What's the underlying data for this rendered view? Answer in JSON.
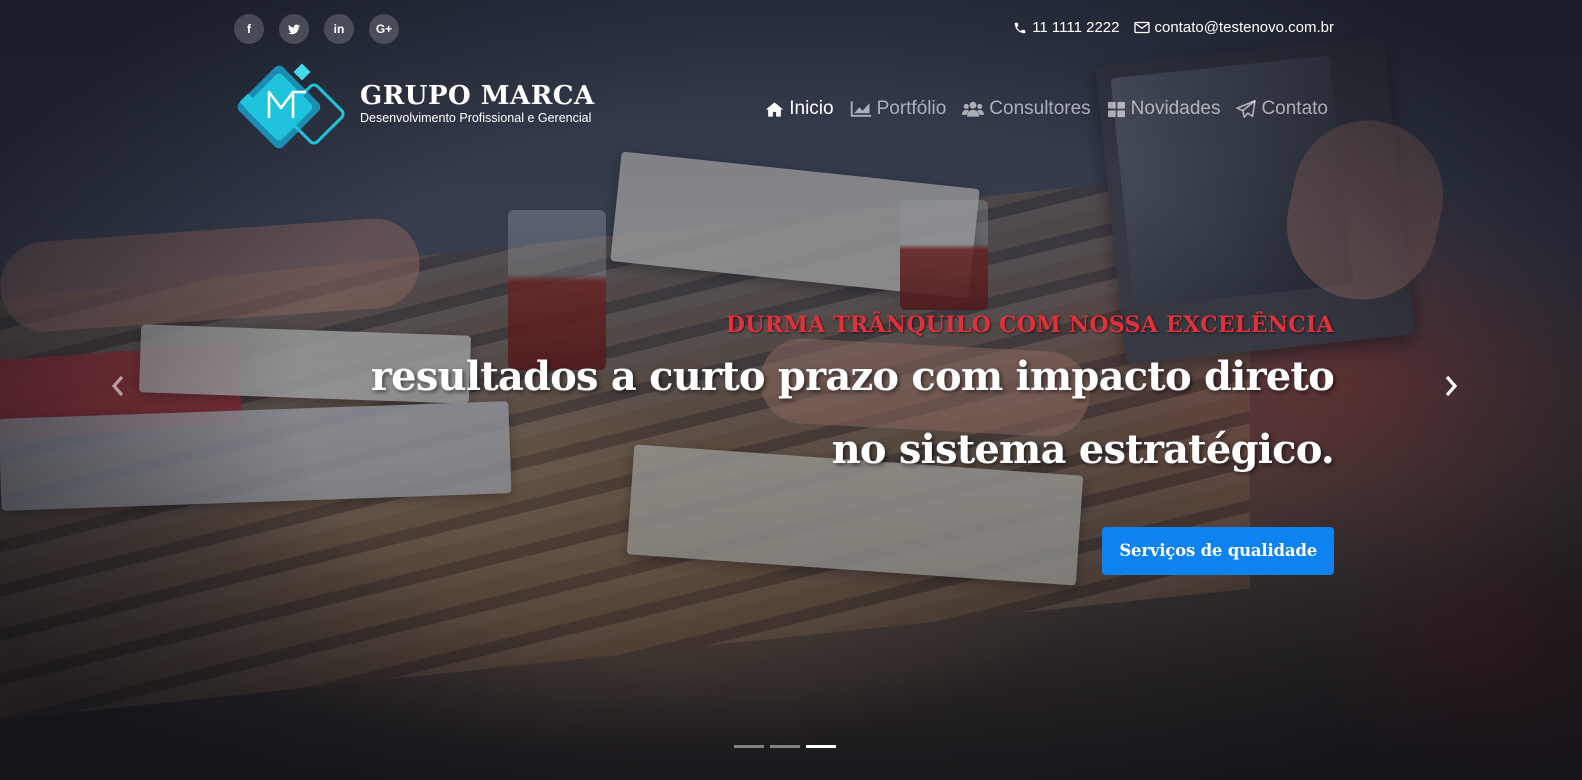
{
  "topbar": {
    "social": [
      {
        "name": "facebook",
        "glyph": "f"
      },
      {
        "name": "twitter",
        "glyph": "t"
      },
      {
        "name": "linkedin",
        "glyph": "in"
      },
      {
        "name": "google-plus",
        "glyph": "G+"
      }
    ],
    "phone": "11 1111 2222",
    "email": "contato@testenovo.com.br"
  },
  "brand": {
    "name": "GRUPO MARCA",
    "tagline": "Desenvolvimento Profissional e Gerencial",
    "logo_letter": "M",
    "logo_colors": [
      "#1fc4dc",
      "#1a9fc8",
      "#ffffff"
    ]
  },
  "nav": {
    "items": [
      {
        "label": "Inicio",
        "icon": "home-icon",
        "active": true
      },
      {
        "label": "Portfólio",
        "icon": "area-chart-icon",
        "active": false
      },
      {
        "label": "Consultores",
        "icon": "users-icon",
        "active": false
      },
      {
        "label": "Novidades",
        "icon": "grid-icon",
        "active": false
      },
      {
        "label": "Contato",
        "icon": "paper-plane-icon",
        "active": false
      }
    ]
  },
  "slide": {
    "kicker": "DURMA TRÂNQUILO COM NOSSA EXCELÊNCIA",
    "headline_line1": "resultados a curto prazo com impacto direto",
    "headline_line2": "no sistema estratégico.",
    "cta_label": "Serviços de qualidade"
  },
  "carousel": {
    "slide_count": 3,
    "active_index": 2
  },
  "colors": {
    "accent_red": "#e0303a",
    "cta_blue": "#0d82f0",
    "logo_cyan": "#1fc4dc"
  }
}
